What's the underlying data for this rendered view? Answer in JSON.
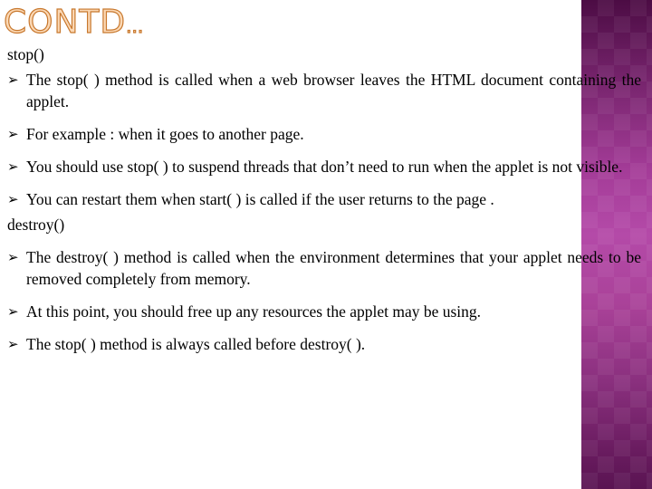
{
  "slide": {
    "title": "CONTD",
    "title_suffix": "...",
    "accent_colors": {
      "title_fill": "#fbd8b4",
      "title_outline": "#c8782e",
      "side_bar_top": "#4c0c44",
      "side_bar_mid": "#b44aa8",
      "side_bar_bottom": "#5a1452"
    },
    "bullet_icon": "arrowhead-bullet",
    "bullet_glyph": "➢",
    "sections": [
      {
        "heading": "stop()",
        "bullets": [
          "The stop( ) method is called when a web browser leaves the HTML document containing the applet.",
          "For example : when it goes to another page.",
          "You should use stop( ) to suspend threads that don’t need to run when the applet is not visible.",
          "You can restart them when start( ) is called if the user returns to the page ."
        ]
      },
      {
        "heading": "destroy()",
        "bullets": [
          "The destroy( ) method is called when the environment determines that your applet needs to be removed completely from memory.",
          "At this point, you should free up any resources the applet may be using.",
          "The stop( ) method is always called before destroy( )."
        ]
      }
    ]
  }
}
